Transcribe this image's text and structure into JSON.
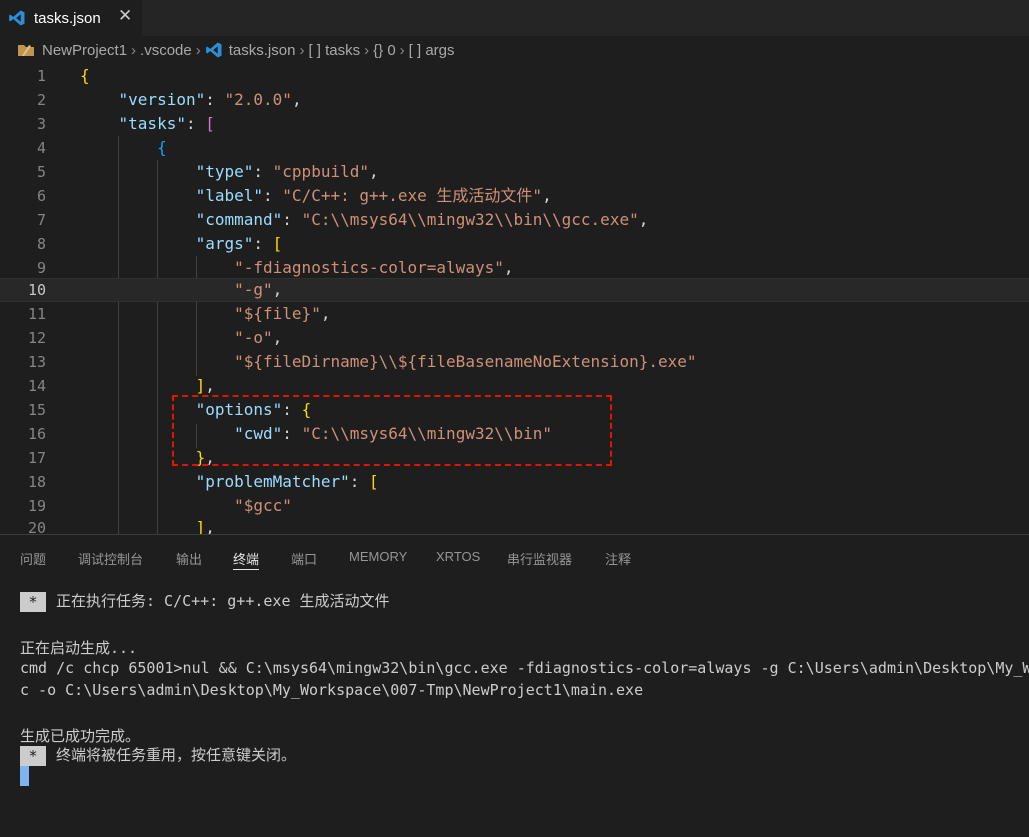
{
  "tab": {
    "filename": "tasks.json",
    "close": "✕"
  },
  "breadcrumb": {
    "project": "NewProject1",
    "vscode": ".vscode",
    "file": "tasks.json",
    "tasks": "[ ] tasks",
    "index": "{} 0",
    "args": "[ ] args"
  },
  "code": {
    "line_numbers": [
      "1",
      "2",
      "3",
      "4",
      "5",
      "6",
      "7",
      "8",
      "9",
      "10",
      "11",
      "12",
      "13",
      "14",
      "15",
      "16",
      "17",
      "18",
      "19",
      "20"
    ],
    "version_key": "\"version\"",
    "version_val": "\"2.0.0\"",
    "tasks_key": "\"tasks\"",
    "type_key": "\"type\"",
    "type_val": "\"cppbuild\"",
    "label_key": "\"label\"",
    "label_val": "\"C/C++: g++.exe 生成活动文件\"",
    "command_key": "\"command\"",
    "command_val": "\"C:\\\\msys64\\\\mingw32\\\\bin\\\\gcc.exe\"",
    "args_key": "\"args\"",
    "arg1": "\"-fdiagnostics-color=always\"",
    "arg2": "\"-g\"",
    "arg3": "\"${file}\"",
    "arg4": "\"-o\"",
    "arg5": "\"${fileDirname}\\\\${fileBasenameNoExtension}.exe\"",
    "options_key": "\"options\"",
    "cwd_key": "\"cwd\"",
    "cwd_val": "\"C:\\\\msys64\\\\mingw32\\\\bin\"",
    "problem_key": "\"problemMatcher\"",
    "gcc_val": "\"$gcc\""
  },
  "panel": {
    "tabs": [
      "问题",
      "调试控制台",
      "输出",
      "终端",
      "端口",
      "MEMORY",
      "XRTOS",
      "串行监视器",
      "注释"
    ],
    "active_tab": "终端"
  },
  "terminal": {
    "star": "*",
    "running": "正在执行任务: C/C++: g++.exe 生成活动文件",
    "starting": "正在启动生成...",
    "cmd1": "cmd /c chcp 65001>nul && C:\\msys64\\mingw32\\bin\\gcc.exe -fdiagnostics-color=always -g C:\\Users\\admin\\Desktop\\My_W",
    "cmd2": "c -o C:\\Users\\admin\\Desktop\\My_Workspace\\007-Tmp\\NewProject1\\main.exe",
    "done": "生成已成功完成。",
    "reuse": "终端将被任务重用，按任意键关闭。"
  }
}
